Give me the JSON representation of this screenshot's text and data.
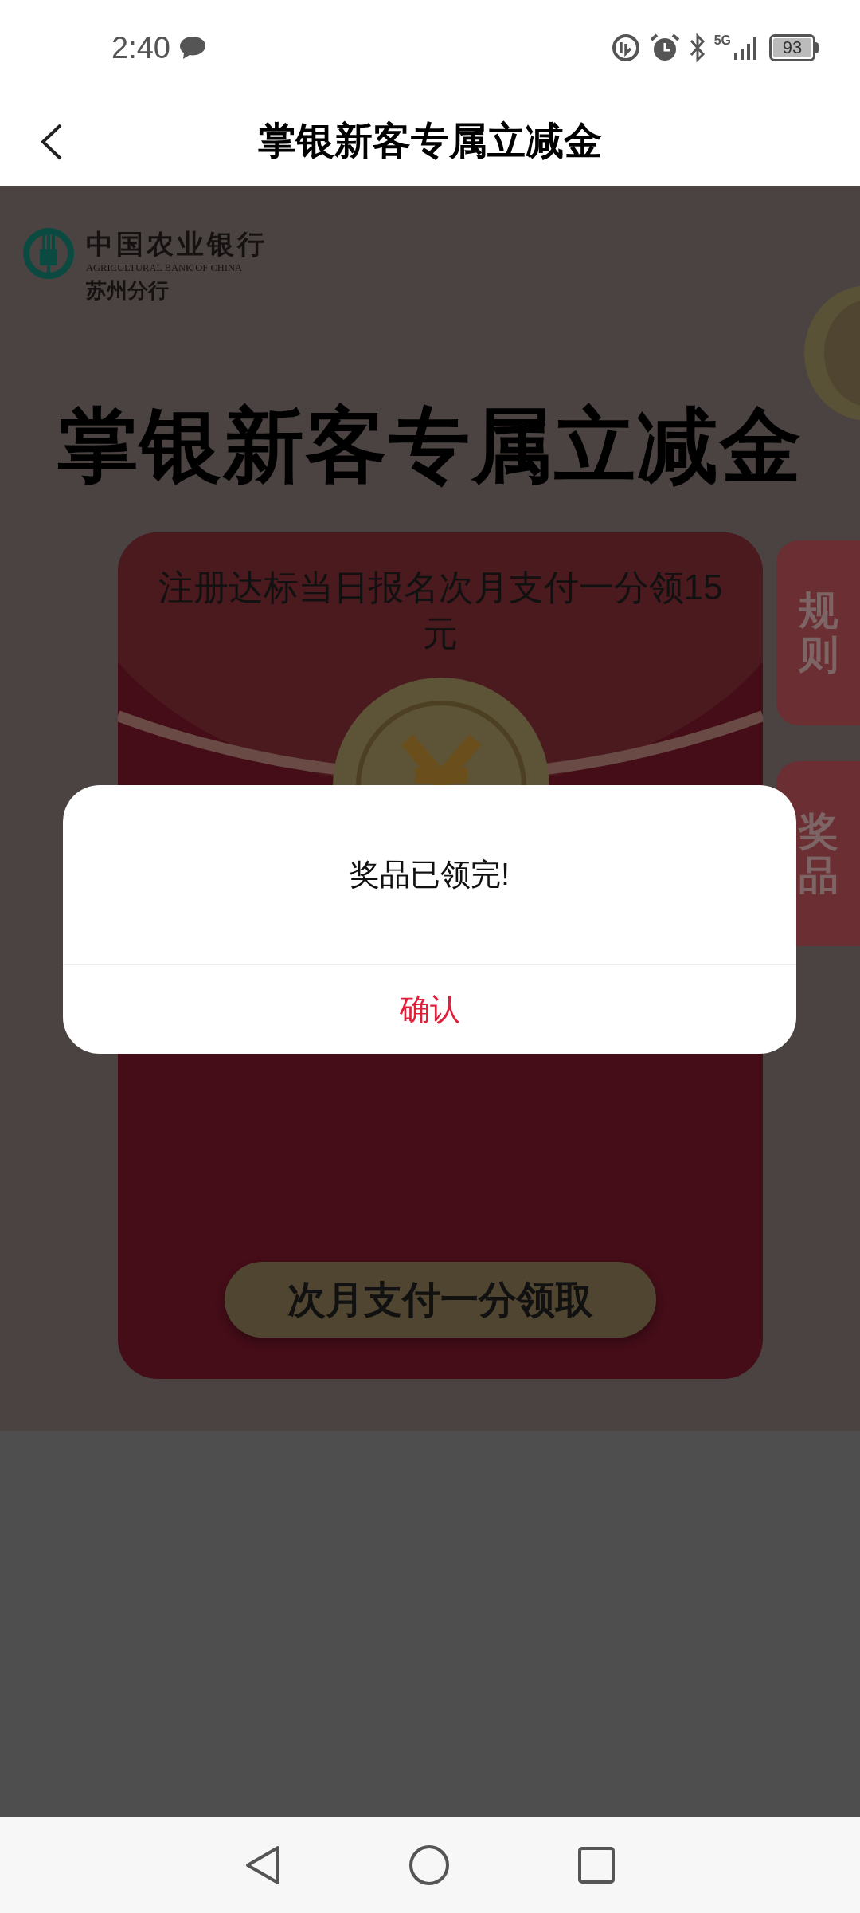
{
  "status_bar": {
    "time": "2:40",
    "network": "5G",
    "battery": "93"
  },
  "nav_bar": {
    "title": "掌银新客专属立减金"
  },
  "page": {
    "bank_logo": {
      "name_cn": "中国农业银行",
      "name_en": "AGRICULTURAL BANK OF CHINA",
      "branch": "苏州分行"
    },
    "headline": "掌银新客专属立减金",
    "card": {
      "description": "注册达标当日报名次月支付一分领15元",
      "button": "次月支付一分领取"
    },
    "side_tabs": [
      {
        "label": "规则"
      },
      {
        "label": "奖品"
      }
    ]
  },
  "dialog": {
    "message": "奖品已领完!",
    "confirm": "确认"
  }
}
